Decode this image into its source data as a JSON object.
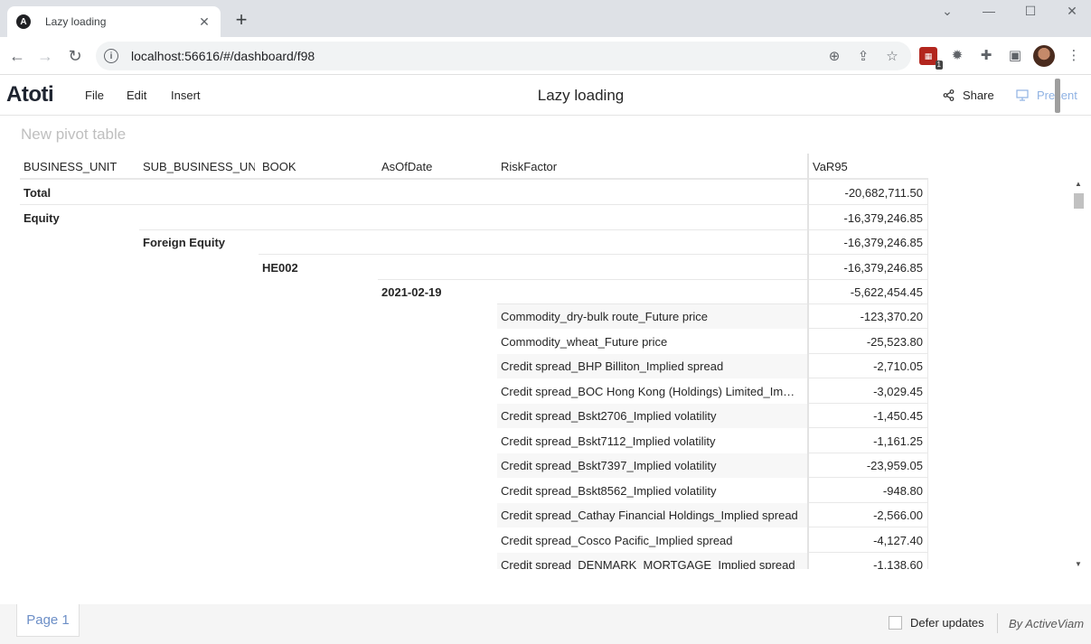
{
  "browser": {
    "tab_title": "Lazy loading",
    "favicon_letter": "A",
    "url": "localhost:56616/#/dashboard/f98",
    "extension_badge": "1"
  },
  "app": {
    "logo": "Atoti",
    "menu": [
      "File",
      "Edit",
      "Insert"
    ],
    "title": "Lazy loading",
    "share_label": "Share",
    "present_label": "Present"
  },
  "widget": {
    "title": "New pivot table",
    "columns": [
      "BUSINESS_UNIT",
      "SUB_BUSINESS_UNIT",
      "BOOK",
      "AsOfDate",
      "RiskFactor",
      "VaR95"
    ],
    "rows": [
      {
        "level": 0,
        "label": "Total",
        "value": "-20,682,711.50"
      },
      {
        "level": 0,
        "label": "Equity",
        "value": "-16,379,246.85"
      },
      {
        "level": 1,
        "label": "Foreign Equity",
        "value": "-16,379,246.85"
      },
      {
        "level": 2,
        "label": "HE002",
        "value": "-16,379,246.85"
      },
      {
        "level": 3,
        "label": "2021-02-19",
        "value": "-5,622,454.45"
      },
      {
        "level": 4,
        "label": "Commodity_dry-bulk route_Future price",
        "value": "-123,370.20"
      },
      {
        "level": 4,
        "label": "Commodity_wheat_Future price",
        "value": "-25,523.80"
      },
      {
        "level": 4,
        "label": "Credit spread_BHP Billiton_Implied spread",
        "value": "-2,710.05"
      },
      {
        "level": 4,
        "label": "Credit spread_BOC Hong Kong (Holdings) Limited_Implied spread",
        "value": "-3,029.45"
      },
      {
        "level": 4,
        "label": "Credit spread_Bskt2706_Implied volatility",
        "value": "-1,450.45"
      },
      {
        "level": 4,
        "label": "Credit spread_Bskt7112_Implied volatility",
        "value": "-1,161.25"
      },
      {
        "level": 4,
        "label": "Credit spread_Bskt7397_Implied volatility",
        "value": "-23,959.05"
      },
      {
        "level": 4,
        "label": "Credit spread_Bskt8562_Implied volatility",
        "value": "-948.80"
      },
      {
        "level": 4,
        "label": "Credit spread_Cathay Financial Holdings_Implied spread",
        "value": "-2,566.00"
      },
      {
        "level": 4,
        "label": "Credit spread_Cosco Pacific_Implied spread",
        "value": "-4,127.40"
      },
      {
        "level": 4,
        "label": "Credit spread_DENMARK_MORTGAGE_Implied spread",
        "value": "-1,138.60"
      }
    ]
  },
  "footer": {
    "page_tab": "Page 1",
    "defer_label": "Defer updates",
    "by_label": "By ActiveViam"
  }
}
